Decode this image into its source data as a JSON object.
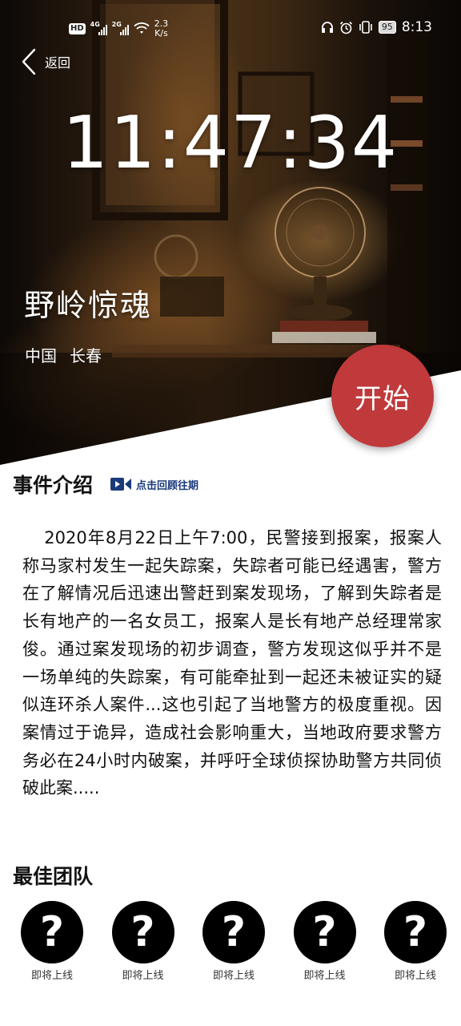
{
  "status_bar": {
    "left_badge": "HD",
    "network_1": "4G",
    "network_2": "2G",
    "speed_value": "2.3",
    "speed_unit": "K/s",
    "battery": "95",
    "time": "8:13",
    "icons": [
      "headphones-icon",
      "alarm-icon",
      "vibrate-icon",
      "battery-icon"
    ]
  },
  "nav": {
    "back_label": "返回"
  },
  "hero": {
    "countdown": "11:47:34",
    "title": "野岭惊魂",
    "location": {
      "country": "中国",
      "city": "长春"
    },
    "start_label": "开始",
    "start_color": "#c0393b"
  },
  "event_intro": {
    "title": "事件介绍",
    "replay_label": "点击回顾往期",
    "replay_color": "#1b3a7a",
    "text": "2020年8月22日上午7:00，民警接到报案，报案人称马家村发生一起失踪案，失踪者可能已经遇害，警方在了解情况后迅速出警赶到案发现场，了解到失踪者是长有地产的一名女员工，报案人是长有地产总经理常家俊。通过案发现场的初步调查，警方发现这似乎并不是一场单纯的失踪案，有可能牵扯到一起还未被证实的疑似连环杀人案件...这也引起了当地警方的极度重视。因案情过于诡异，造成社会影响重大，当地政府要求警方务必在24小时内破案，并呼吁全球侦探协助警方共同侦破此案....."
  },
  "best_team": {
    "title": "最佳团队",
    "members": [
      {
        "symbol": "?",
        "label": "即将上线"
      },
      {
        "symbol": "?",
        "label": "即将上线"
      },
      {
        "symbol": "?",
        "label": "即将上线"
      },
      {
        "symbol": "?",
        "label": "即将上线"
      },
      {
        "symbol": "?",
        "label": "即将上线"
      }
    ]
  }
}
